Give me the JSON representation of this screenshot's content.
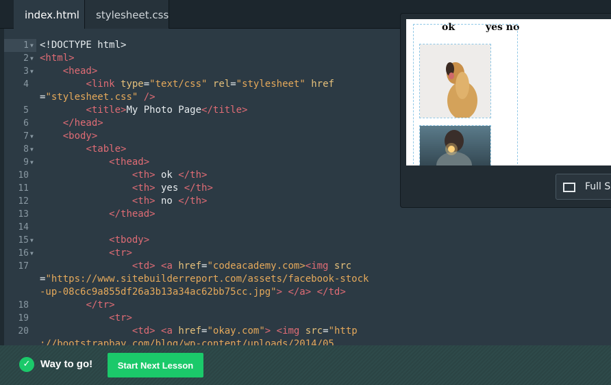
{
  "tabs": [
    {
      "label": "index.html",
      "active": true
    },
    {
      "label": "stylesheet.css",
      "active": false
    }
  ],
  "editor": {
    "lines": [
      {
        "n": "1",
        "fold": true,
        "tokens": [
          [
            "txt",
            "<!DOCTYPE html>"
          ]
        ]
      },
      {
        "n": "2",
        "fold": true,
        "tokens": [
          [
            "tag",
            "<html>"
          ]
        ]
      },
      {
        "n": "3",
        "fold": true,
        "tokens": [
          [
            "txt",
            "    "
          ],
          [
            "tag",
            "<head>"
          ]
        ]
      },
      {
        "n": "4",
        "fold": false,
        "tokens": [
          [
            "txt",
            "        "
          ],
          [
            "tag",
            "<link "
          ],
          [
            "attr",
            "type"
          ],
          [
            "txt",
            "="
          ],
          [
            "str",
            "\"text/css\""
          ],
          [
            "txt",
            " "
          ],
          [
            "attr",
            "rel"
          ],
          [
            "txt",
            "="
          ],
          [
            "str",
            "\"stylesheet\""
          ],
          [
            "txt",
            " "
          ],
          [
            "attr",
            "href"
          ]
        ]
      },
      {
        "n": "",
        "fold": false,
        "tokens": [
          [
            "txt",
            "="
          ],
          [
            "str",
            "\"stylesheet.css\""
          ],
          [
            "txt",
            " "
          ],
          [
            "tag",
            "/>"
          ]
        ]
      },
      {
        "n": "5",
        "fold": false,
        "tokens": [
          [
            "txt",
            "        "
          ],
          [
            "tag",
            "<title>"
          ],
          [
            "txt",
            "My Photo Page"
          ],
          [
            "tag",
            "</title>"
          ]
        ]
      },
      {
        "n": "6",
        "fold": false,
        "tokens": [
          [
            "txt",
            "    "
          ],
          [
            "tag",
            "</head>"
          ]
        ]
      },
      {
        "n": "7",
        "fold": true,
        "tokens": [
          [
            "txt",
            "    "
          ],
          [
            "tag",
            "<body>"
          ]
        ]
      },
      {
        "n": "8",
        "fold": true,
        "tokens": [
          [
            "txt",
            "        "
          ],
          [
            "tag",
            "<table>"
          ]
        ]
      },
      {
        "n": "9",
        "fold": true,
        "tokens": [
          [
            "txt",
            "            "
          ],
          [
            "tag",
            "<thead>"
          ]
        ]
      },
      {
        "n": "10",
        "fold": false,
        "tokens": [
          [
            "txt",
            "                "
          ],
          [
            "tag",
            "<th>"
          ],
          [
            "txt",
            " ok "
          ],
          [
            "tag",
            "</th>"
          ]
        ]
      },
      {
        "n": "11",
        "fold": false,
        "tokens": [
          [
            "txt",
            "                "
          ],
          [
            "tag",
            "<th>"
          ],
          [
            "txt",
            " yes "
          ],
          [
            "tag",
            "</th>"
          ]
        ]
      },
      {
        "n": "12",
        "fold": false,
        "tokens": [
          [
            "txt",
            "                "
          ],
          [
            "tag",
            "<th>"
          ],
          [
            "txt",
            " no "
          ],
          [
            "tag",
            "</th>"
          ]
        ]
      },
      {
        "n": "13",
        "fold": false,
        "tokens": [
          [
            "txt",
            "            "
          ],
          [
            "tag",
            "</thead>"
          ]
        ]
      },
      {
        "n": "14",
        "fold": false,
        "tokens": [
          [
            "txt",
            ""
          ]
        ]
      },
      {
        "n": "15",
        "fold": true,
        "tokens": [
          [
            "txt",
            "            "
          ],
          [
            "tag",
            "<tbody>"
          ]
        ]
      },
      {
        "n": "16",
        "fold": true,
        "tokens": [
          [
            "txt",
            "            "
          ],
          [
            "tag",
            "<tr>"
          ]
        ]
      },
      {
        "n": "17",
        "fold": false,
        "tokens": [
          [
            "txt",
            "                "
          ],
          [
            "tag",
            "<td>"
          ],
          [
            "txt",
            " "
          ],
          [
            "tag",
            "<a "
          ],
          [
            "attr",
            "href"
          ],
          [
            "txt",
            "="
          ],
          [
            "str",
            "\"codeacademy.com>"
          ],
          [
            "tag",
            "<img "
          ],
          [
            "attr",
            "src"
          ]
        ]
      },
      {
        "n": "",
        "fold": false,
        "tokens": [
          [
            "txt",
            "="
          ],
          [
            "str",
            "\"https://www.sitebuilderreport.com/assets/facebook-stock"
          ]
        ]
      },
      {
        "n": "",
        "fold": false,
        "tokens": [
          [
            "str",
            "-up-08c6c9a855df26a3b13a34ac62bb75cc.jpg\""
          ],
          [
            "tag",
            ">"
          ],
          [
            "txt",
            " "
          ],
          [
            "tag",
            "</a>"
          ],
          [
            "txt",
            " "
          ],
          [
            "tag",
            "</td>"
          ]
        ]
      },
      {
        "n": "18",
        "fold": false,
        "tokens": [
          [
            "txt",
            "        "
          ],
          [
            "tag",
            "</tr>"
          ]
        ]
      },
      {
        "n": "19",
        "fold": false,
        "tokens": [
          [
            "txt",
            "            "
          ],
          [
            "tag",
            "<tr>"
          ]
        ]
      },
      {
        "n": "20",
        "fold": false,
        "tokens": [
          [
            "txt",
            "                "
          ],
          [
            "tag",
            "<td>"
          ],
          [
            "txt",
            " "
          ],
          [
            "tag",
            "<a "
          ],
          [
            "attr",
            "href"
          ],
          [
            "txt",
            "="
          ],
          [
            "str",
            "\"okay.com\""
          ],
          [
            "tag",
            ">"
          ],
          [
            "txt",
            " "
          ],
          [
            "tag",
            "<img "
          ],
          [
            "attr",
            "src"
          ],
          [
            "txt",
            "="
          ],
          [
            "str",
            "\"http"
          ]
        ]
      },
      {
        "n": "",
        "fold": false,
        "tokens": [
          [
            "str",
            "://bootstrapbay.com/blog/wp-content/uploads/2014/05"
          ]
        ]
      }
    ]
  },
  "preview": {
    "headers": [
      "ok",
      "yes no"
    ],
    "fullscreen_label": "Full Sc"
  },
  "bottom": {
    "status": "Way to go!",
    "next_label": "Start Next Lesson"
  },
  "colors": {
    "tag": "#e06c75",
    "attr": "#e5c07b",
    "string": "#e5a95b",
    "success": "#1bc96a"
  }
}
